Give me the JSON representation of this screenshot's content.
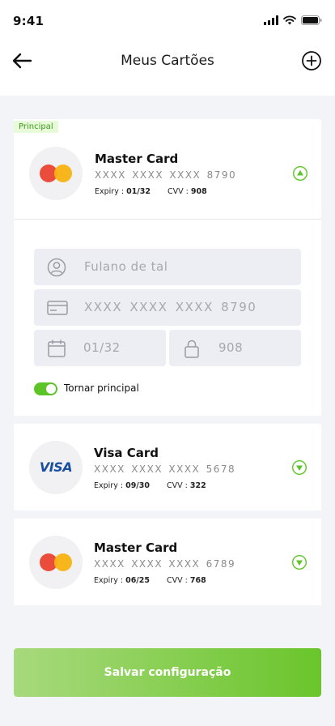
{
  "status": {
    "time": "9:41"
  },
  "header": {
    "title": "Meus Cartões"
  },
  "cards": [
    {
      "badge": "Principal",
      "name": "Master Card",
      "number": "XXXX XXXX XXXX 8790",
      "expiry_label": "Expiry :",
      "expiry": "01/32",
      "cvv_label": "CVV :",
      "cvv": "908",
      "expanded": true
    },
    {
      "name": "Visa Card",
      "logo_text": "VISA",
      "number": "XXXX XXXX XXXX 5678",
      "expiry_label": "Expiry :",
      "expiry": "09/30",
      "cvv_label": "CVV :",
      "cvv": "322",
      "expanded": false
    },
    {
      "name": "Master Card",
      "number": "XXXX XXXX XXXX 6789",
      "expiry_label": "Expiry :",
      "expiry": "06/25",
      "cvv_label": "CVV :",
      "cvv": "768",
      "expanded": false
    }
  ],
  "form": {
    "holder": "Fulano de tal",
    "number": "XXXX XXXX XXXX 8790",
    "expiry": "01/32",
    "cvv": "908",
    "make_primary_label": "Tornar principal",
    "make_primary_on": true
  },
  "save_button": "Salvar configuração",
  "colors": {
    "accent": "#5dc428",
    "badge_bg": "#e7fbd9",
    "field_bg": "#eceef3"
  }
}
